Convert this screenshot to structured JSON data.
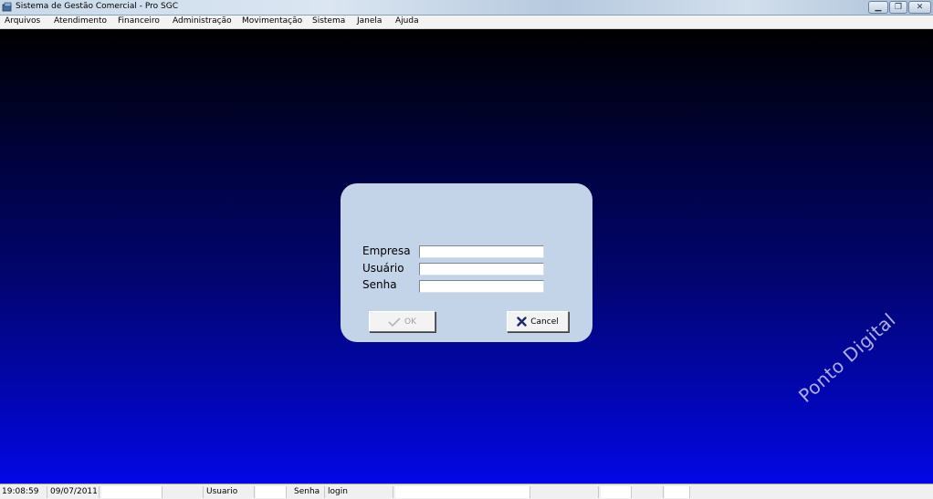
{
  "window": {
    "title": "Sistema de Gestão Comercial - Pro SGC",
    "minimize_label": "▁",
    "restore_label": "❐",
    "close_label": "✕"
  },
  "menu": {
    "items": [
      {
        "label": "Arquivos"
      },
      {
        "label": "Atendimento"
      },
      {
        "label": "Financeiro"
      },
      {
        "label": "Administração"
      },
      {
        "label": "Movimentação"
      },
      {
        "label": "Sistema"
      },
      {
        "label": "Janela"
      },
      {
        "label": "Ajuda"
      }
    ]
  },
  "login": {
    "empresa_label": "Empresa",
    "usuario_label": "Usuário",
    "senha_label": "Senha",
    "empresa_value": "",
    "usuario_value": "",
    "senha_value": "",
    "ok_label": "OK",
    "cancel_label": "Cancel",
    "ok_enabled": false
  },
  "watermark": "Ponto Digital",
  "statusbar": {
    "time": "19:08:59",
    "date": "09/07/2011",
    "user_label": "Usuario",
    "user_value": "",
    "senha_label": "Senha",
    "login_value": "login"
  },
  "colors": {
    "desktop_top": "#000000",
    "desktop_bottom": "#0307e6",
    "panel": "#c3d3e8",
    "cancel_icon": "#1a2a6c"
  },
  "icons": {
    "app": "app-icon",
    "ok": "check-icon",
    "cancel": "x-icon"
  }
}
